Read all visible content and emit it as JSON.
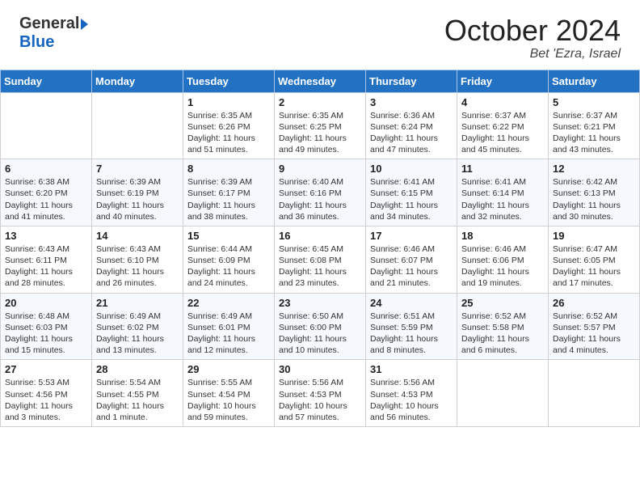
{
  "header": {
    "logo_general": "General",
    "logo_blue": "Blue",
    "month_title": "October 2024",
    "location": "Bet 'Ezra, Israel"
  },
  "days_of_week": [
    "Sunday",
    "Monday",
    "Tuesday",
    "Wednesday",
    "Thursday",
    "Friday",
    "Saturday"
  ],
  "weeks": [
    [
      {
        "day": "",
        "info": ""
      },
      {
        "day": "",
        "info": ""
      },
      {
        "day": "1",
        "info": "Sunrise: 6:35 AM\nSunset: 6:26 PM\nDaylight: 11 hours and 51 minutes."
      },
      {
        "day": "2",
        "info": "Sunrise: 6:35 AM\nSunset: 6:25 PM\nDaylight: 11 hours and 49 minutes."
      },
      {
        "day": "3",
        "info": "Sunrise: 6:36 AM\nSunset: 6:24 PM\nDaylight: 11 hours and 47 minutes."
      },
      {
        "day": "4",
        "info": "Sunrise: 6:37 AM\nSunset: 6:22 PM\nDaylight: 11 hours and 45 minutes."
      },
      {
        "day": "5",
        "info": "Sunrise: 6:37 AM\nSunset: 6:21 PM\nDaylight: 11 hours and 43 minutes."
      }
    ],
    [
      {
        "day": "6",
        "info": "Sunrise: 6:38 AM\nSunset: 6:20 PM\nDaylight: 11 hours and 41 minutes."
      },
      {
        "day": "7",
        "info": "Sunrise: 6:39 AM\nSunset: 6:19 PM\nDaylight: 11 hours and 40 minutes."
      },
      {
        "day": "8",
        "info": "Sunrise: 6:39 AM\nSunset: 6:17 PM\nDaylight: 11 hours and 38 minutes."
      },
      {
        "day": "9",
        "info": "Sunrise: 6:40 AM\nSunset: 6:16 PM\nDaylight: 11 hours and 36 minutes."
      },
      {
        "day": "10",
        "info": "Sunrise: 6:41 AM\nSunset: 6:15 PM\nDaylight: 11 hours and 34 minutes."
      },
      {
        "day": "11",
        "info": "Sunrise: 6:41 AM\nSunset: 6:14 PM\nDaylight: 11 hours and 32 minutes."
      },
      {
        "day": "12",
        "info": "Sunrise: 6:42 AM\nSunset: 6:13 PM\nDaylight: 11 hours and 30 minutes."
      }
    ],
    [
      {
        "day": "13",
        "info": "Sunrise: 6:43 AM\nSunset: 6:11 PM\nDaylight: 11 hours and 28 minutes."
      },
      {
        "day": "14",
        "info": "Sunrise: 6:43 AM\nSunset: 6:10 PM\nDaylight: 11 hours and 26 minutes."
      },
      {
        "day": "15",
        "info": "Sunrise: 6:44 AM\nSunset: 6:09 PM\nDaylight: 11 hours and 24 minutes."
      },
      {
        "day": "16",
        "info": "Sunrise: 6:45 AM\nSunset: 6:08 PM\nDaylight: 11 hours and 23 minutes."
      },
      {
        "day": "17",
        "info": "Sunrise: 6:46 AM\nSunset: 6:07 PM\nDaylight: 11 hours and 21 minutes."
      },
      {
        "day": "18",
        "info": "Sunrise: 6:46 AM\nSunset: 6:06 PM\nDaylight: 11 hours and 19 minutes."
      },
      {
        "day": "19",
        "info": "Sunrise: 6:47 AM\nSunset: 6:05 PM\nDaylight: 11 hours and 17 minutes."
      }
    ],
    [
      {
        "day": "20",
        "info": "Sunrise: 6:48 AM\nSunset: 6:03 PM\nDaylight: 11 hours and 15 minutes."
      },
      {
        "day": "21",
        "info": "Sunrise: 6:49 AM\nSunset: 6:02 PM\nDaylight: 11 hours and 13 minutes."
      },
      {
        "day": "22",
        "info": "Sunrise: 6:49 AM\nSunset: 6:01 PM\nDaylight: 11 hours and 12 minutes."
      },
      {
        "day": "23",
        "info": "Sunrise: 6:50 AM\nSunset: 6:00 PM\nDaylight: 11 hours and 10 minutes."
      },
      {
        "day": "24",
        "info": "Sunrise: 6:51 AM\nSunset: 5:59 PM\nDaylight: 11 hours and 8 minutes."
      },
      {
        "day": "25",
        "info": "Sunrise: 6:52 AM\nSunset: 5:58 PM\nDaylight: 11 hours and 6 minutes."
      },
      {
        "day": "26",
        "info": "Sunrise: 6:52 AM\nSunset: 5:57 PM\nDaylight: 11 hours and 4 minutes."
      }
    ],
    [
      {
        "day": "27",
        "info": "Sunrise: 5:53 AM\nSunset: 4:56 PM\nDaylight: 11 hours and 3 minutes."
      },
      {
        "day": "28",
        "info": "Sunrise: 5:54 AM\nSunset: 4:55 PM\nDaylight: 11 hours and 1 minute."
      },
      {
        "day": "29",
        "info": "Sunrise: 5:55 AM\nSunset: 4:54 PM\nDaylight: 10 hours and 59 minutes."
      },
      {
        "day": "30",
        "info": "Sunrise: 5:56 AM\nSunset: 4:53 PM\nDaylight: 10 hours and 57 minutes."
      },
      {
        "day": "31",
        "info": "Sunrise: 5:56 AM\nSunset: 4:53 PM\nDaylight: 10 hours and 56 minutes."
      },
      {
        "day": "",
        "info": ""
      },
      {
        "day": "",
        "info": ""
      }
    ]
  ]
}
